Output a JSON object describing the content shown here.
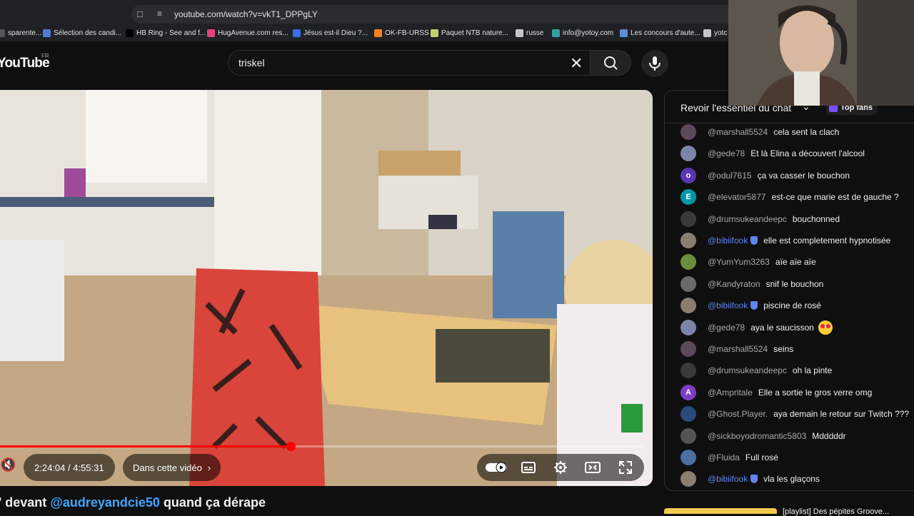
{
  "browser": {
    "url": "youtube.com/watch?v=vkT1_DPPgLY",
    "bookmarks": [
      {
        "label": "sparente...",
        "icon": "page-icon",
        "color": "#555555"
      },
      {
        "label": "Sélection des candi...",
        "icon": "doc-icon",
        "color": "#4a7dd8"
      },
      {
        "label": "HB Ring - See and f...",
        "icon": "hb-icon",
        "color": "#000000"
      },
      {
        "label": "HugAvenue.com res...",
        "icon": "heart-icon",
        "color": "#e4447a"
      },
      {
        "label": "Jésus est-il Dieu ?...",
        "icon": "globe-icon",
        "color": "#3a6ee8"
      },
      {
        "label": "OK-FB-URSS",
        "icon": "ok-icon",
        "color": "#f58220"
      },
      {
        "label": "Paquet NTB nature...",
        "icon": "leaf-icon",
        "color": "#c2d36a"
      },
      {
        "label": "russe",
        "icon": "folder-icon",
        "color": "#c4c7c5"
      },
      {
        "label": "info@yotoy.com",
        "icon": "mail-icon",
        "color": "#33a1a1"
      },
      {
        "label": "Les concours d'aute...",
        "icon": "trophy-icon",
        "color": "#5b8ed6"
      },
      {
        "label": "yotc",
        "icon": "folder-icon",
        "color": "#c4c7c5"
      }
    ]
  },
  "youtube": {
    "logo": "YouTube",
    "region": "FR",
    "search_value": "triskel"
  },
  "player": {
    "progress_fraction": 0.49,
    "time": "2:24:04 / 4:55:31",
    "chapter_label": "Dans cette vidéo"
  },
  "video_title": {
    "prefix": "' devant ",
    "mention": "@audreyandcie50",
    "suffix": " quand ça dérape"
  },
  "chat": {
    "header_title": "Revoir l'essentiel du chat",
    "top_fans_label": "Top fans",
    "messages": [
      {
        "author": "@marshall5524",
        "text": "cela sent la clach",
        "avatar_color": "#5a4a5a",
        "avatar_letter": "",
        "mod": false,
        "emoji": false
      },
      {
        "author": "@gede78",
        "text": "Et là Elina a découvert l'alcool",
        "avatar_color": "#7a86a8",
        "avatar_letter": "",
        "mod": false,
        "emoji": false
      },
      {
        "author": "@odul7615",
        "text": "ça va casser le bouchon",
        "avatar_color": "#5e35b1",
        "avatar_letter": "o",
        "mod": false,
        "emoji": false
      },
      {
        "author": "@elevator5877",
        "text": "est-ce que marie est de gauche ?",
        "avatar_color": "#0097a7",
        "avatar_letter": "E",
        "mod": false,
        "emoji": false
      },
      {
        "author": "@drumsukeandeepc",
        "text": "bouchonned",
        "avatar_color": "#3a3a3a",
        "avatar_letter": "",
        "mod": false,
        "emoji": false
      },
      {
        "author": "@bibiifook",
        "text": "elle est completement hypnotisée",
        "avatar_color": "#8a7f6e",
        "avatar_letter": "",
        "mod": true,
        "emoji": false
      },
      {
        "author": "@YumYum3263",
        "text": "aïe aïe aïe",
        "avatar_color": "#6b8e3a",
        "avatar_letter": "",
        "mod": false,
        "emoji": false
      },
      {
        "author": "@Kandyraton",
        "text": "snif le bouchon",
        "avatar_color": "#6a6a6a",
        "avatar_letter": "",
        "mod": false,
        "emoji": false
      },
      {
        "author": "@bibiifook",
        "text": "piscine de rosé",
        "avatar_color": "#8a7f6e",
        "avatar_letter": "",
        "mod": true,
        "emoji": false
      },
      {
        "author": "@gede78",
        "text": "aya le saucisson",
        "avatar_color": "#7a86a8",
        "avatar_letter": "",
        "mod": false,
        "emoji": true
      },
      {
        "author": "@marshall5524",
        "text": "seins",
        "avatar_color": "#5a4a5a",
        "avatar_letter": "",
        "mod": false,
        "emoji": false
      },
      {
        "author": "@drumsukeandeepc",
        "text": "oh la pinte",
        "avatar_color": "#3a3a3a",
        "avatar_letter": "",
        "mod": false,
        "emoji": false
      },
      {
        "author": "@Ampritale",
        "text": "Elle a sortie le gros verre omg",
        "avatar_color": "#7b3fc4",
        "avatar_letter": "A",
        "mod": false,
        "emoji": false
      },
      {
        "author": "@Ghost.Player.",
        "text": "aya demain le retour sur Twitch ???",
        "avatar_color": "#2a4a7a",
        "avatar_letter": "",
        "mod": false,
        "emoji": false
      },
      {
        "author": "@sickboyodromantic5803",
        "text": "Mdddddr",
        "avatar_color": "#555555",
        "avatar_letter": "",
        "mod": false,
        "emoji": false
      },
      {
        "author": "@Fluida",
        "text": "Full rosé",
        "avatar_color": "#4a6fa0",
        "avatar_letter": "",
        "mod": false,
        "emoji": false
      },
      {
        "author": "@bibiifook",
        "text": "vla les glaçons",
        "avatar_color": "#8a7f6e",
        "avatar_letter": "",
        "mod": true,
        "emoji": false
      }
    ]
  },
  "sidebar_next": {
    "text": "[playlist] Des pépites Groove..."
  }
}
